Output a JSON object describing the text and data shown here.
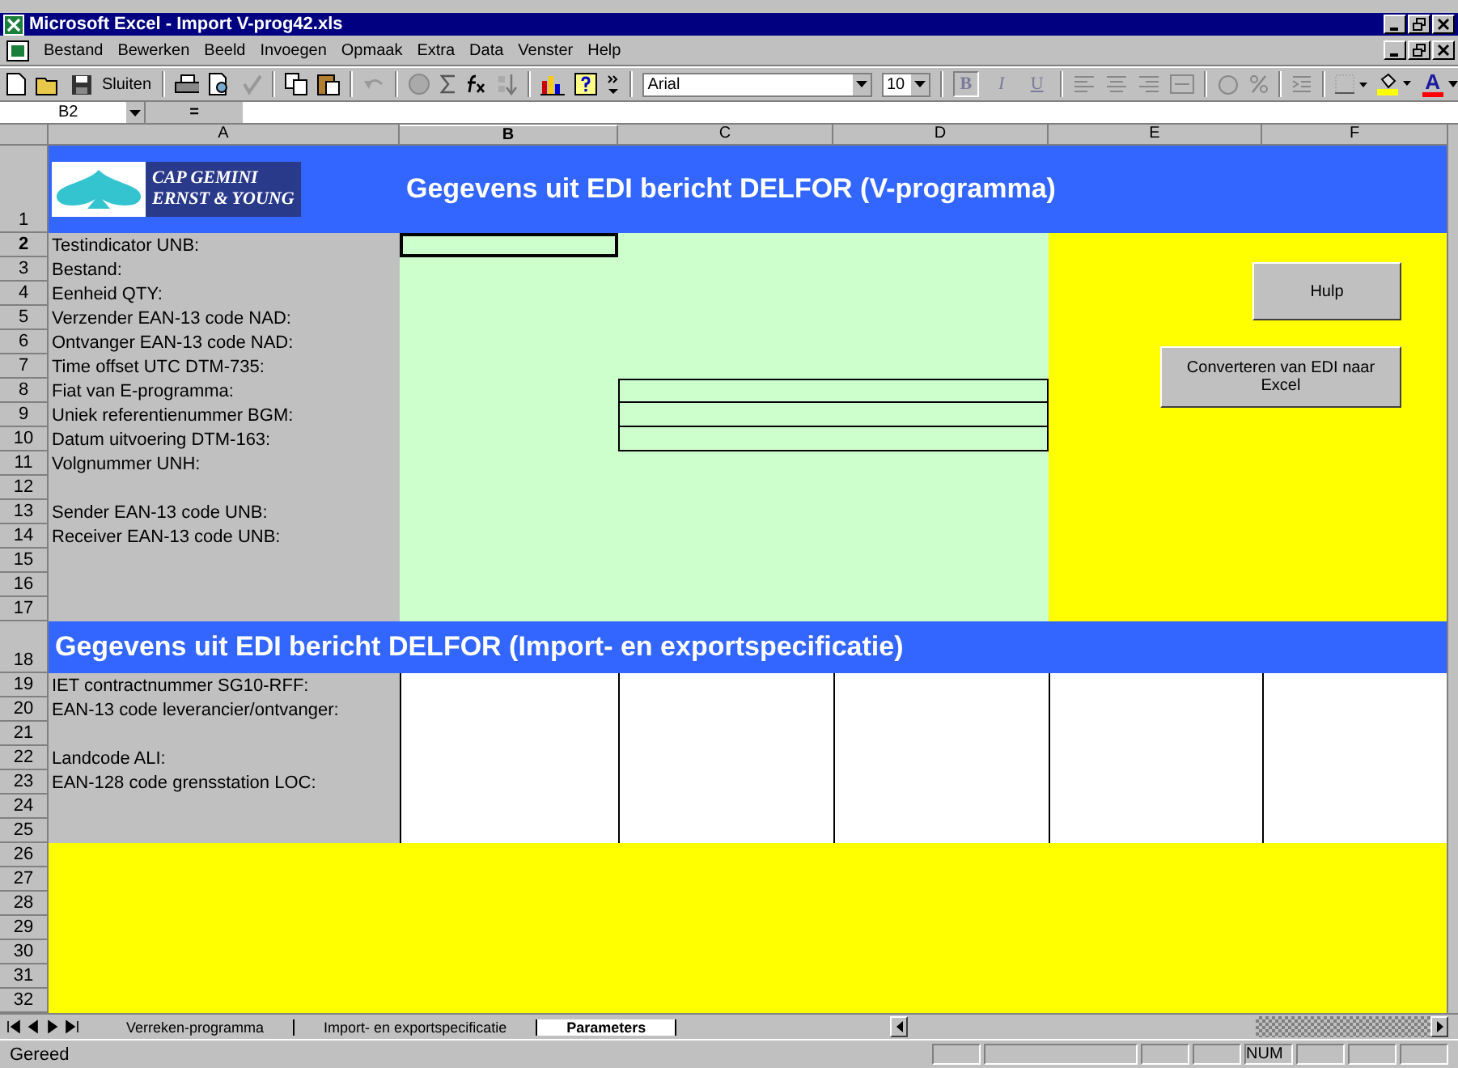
{
  "window": {
    "title": "Microsoft Excel - Import V-prog42.xls"
  },
  "menu": [
    "Bestand",
    "Bewerken",
    "Beeld",
    "Invoegen",
    "Opmaak",
    "Extra",
    "Data",
    "Venster",
    "Help"
  ],
  "toolbar": {
    "close_label": "Sluiten",
    "font": "Arial",
    "size": "10",
    "format_buttons": [
      "B",
      "I",
      "U"
    ],
    "font_color_letter": "A"
  },
  "formula_bar": {
    "name_box": "B2",
    "equals": "="
  },
  "columns": [
    {
      "label": "A",
      "selected": false
    },
    {
      "label": "B",
      "selected": true
    },
    {
      "label": "C",
      "selected": false
    },
    {
      "label": "D",
      "selected": false
    },
    {
      "label": "E",
      "selected": false
    },
    {
      "label": "F",
      "selected": false
    }
  ],
  "rows": [
    {
      "number": "1",
      "kind": "banner",
      "title": "Gegevens uit EDI bericht DELFOR (V-programma)",
      "logo": [
        "CAP GEMINI",
        "ERNST & YOUNG"
      ],
      "selected": false
    },
    {
      "number": "2",
      "kind": "header",
      "label": "Testindicator UNB:",
      "selected": true,
      "boxed": false
    },
    {
      "number": "3",
      "kind": "header",
      "label": "Bestand:",
      "selected": false,
      "boxed": false
    },
    {
      "number": "4",
      "kind": "header",
      "label": "Eenheid QTY:",
      "selected": false,
      "boxed": false
    },
    {
      "number": "5",
      "kind": "header",
      "label": "Verzender EAN-13 code NAD:",
      "selected": false,
      "boxed": false
    },
    {
      "number": "6",
      "kind": "header",
      "label": "Ontvanger EAN-13 code NAD:",
      "selected": false,
      "boxed": false
    },
    {
      "number": "7",
      "kind": "header",
      "label": "Time offset UTC DTM-735:",
      "selected": false,
      "boxed": false
    },
    {
      "number": "8",
      "kind": "header",
      "label": "Fiat van E-programma:",
      "selected": false,
      "boxed": true
    },
    {
      "number": "9",
      "kind": "header",
      "label": "Uniek referentienummer BGM:",
      "selected": false,
      "boxed": true
    },
    {
      "number": "10",
      "kind": "header",
      "label": "Datum uitvoering DTM-163:",
      "selected": false,
      "boxed": true
    },
    {
      "number": "11",
      "kind": "header",
      "label": "Volgnummer UNH:",
      "selected": false,
      "boxed": false
    },
    {
      "number": "12",
      "kind": "header",
      "selected": false,
      "boxed": false
    },
    {
      "number": "13",
      "kind": "header",
      "label": "Sender EAN-13 code UNB:",
      "selected": false,
      "boxed": false
    },
    {
      "number": "14",
      "kind": "header",
      "label": "Receiver EAN-13 code UNB:",
      "selected": false,
      "boxed": false
    },
    {
      "number": "15",
      "kind": "header",
      "selected": false,
      "boxed": false
    },
    {
      "number": "16",
      "kind": "header",
      "selected": false,
      "boxed": false
    },
    {
      "number": "17",
      "kind": "header",
      "selected": false,
      "boxed": false
    },
    {
      "number": "18",
      "kind": "banner",
      "title": "Gegevens uit EDI bericht DELFOR (Import- en exportspecificatie)",
      "selected": false
    },
    {
      "number": "19",
      "kind": "spec",
      "label": "IET contractnummer SG10-RFF:",
      "selected": false
    },
    {
      "number": "20",
      "kind": "spec",
      "label": "EAN-13 code leverancier/ontvanger:",
      "selected": false
    },
    {
      "number": "21",
      "kind": "spec",
      "selected": false
    },
    {
      "number": "22",
      "kind": "spec",
      "label": "Landcode ALI:",
      "selected": false
    },
    {
      "number": "23",
      "kind": "spec",
      "label": "EAN-128 code grensstation LOC:",
      "selected": false
    },
    {
      "number": "24",
      "kind": "spec",
      "selected": false
    },
    {
      "number": "25",
      "kind": "spec",
      "selected": false
    },
    {
      "number": "26",
      "kind": "footer",
      "selected": false
    },
    {
      "number": "27",
      "kind": "footer",
      "selected": false
    },
    {
      "number": "28",
      "kind": "footer",
      "selected": false
    },
    {
      "number": "29",
      "kind": "footer",
      "selected": false
    },
    {
      "number": "30",
      "kind": "footer",
      "selected": false
    },
    {
      "number": "31",
      "kind": "footer",
      "selected": false
    },
    {
      "number": "32",
      "kind": "footer",
      "selected": false
    }
  ],
  "buttons": [
    "Hulp",
    "Converteren van EDI naar Excel"
  ],
  "sheet_tabs": [
    {
      "label": "Verreken-programma",
      "selected": false
    },
    {
      "label": "Import- en exportspecificatie",
      "selected": false
    },
    {
      "label": "Parameters",
      "selected": true
    }
  ],
  "status_bar": {
    "text": "Gereed",
    "indicators": [
      "NUM"
    ]
  }
}
